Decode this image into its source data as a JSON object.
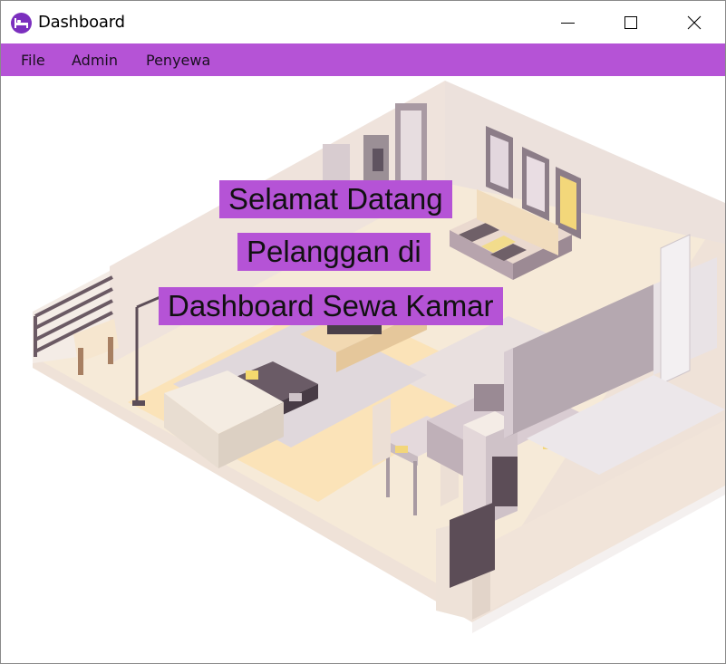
{
  "window": {
    "title": "Dashboard",
    "app_icon": "bed-icon",
    "controls": [
      "minimize-icon",
      "maximize-icon",
      "close-icon"
    ]
  },
  "menubar": {
    "items": [
      {
        "label": "File"
      },
      {
        "label": "Admin"
      },
      {
        "label": "Penyewa"
      }
    ]
  },
  "main": {
    "background_image": "isometric-apartment-illustration",
    "welcome_lines": [
      "Selamat Datang",
      "Pelanggan di",
      "Dashboard Sewa Kamar"
    ]
  },
  "colors": {
    "accent": "#b553d6",
    "app_icon": "#7b2fbe"
  }
}
